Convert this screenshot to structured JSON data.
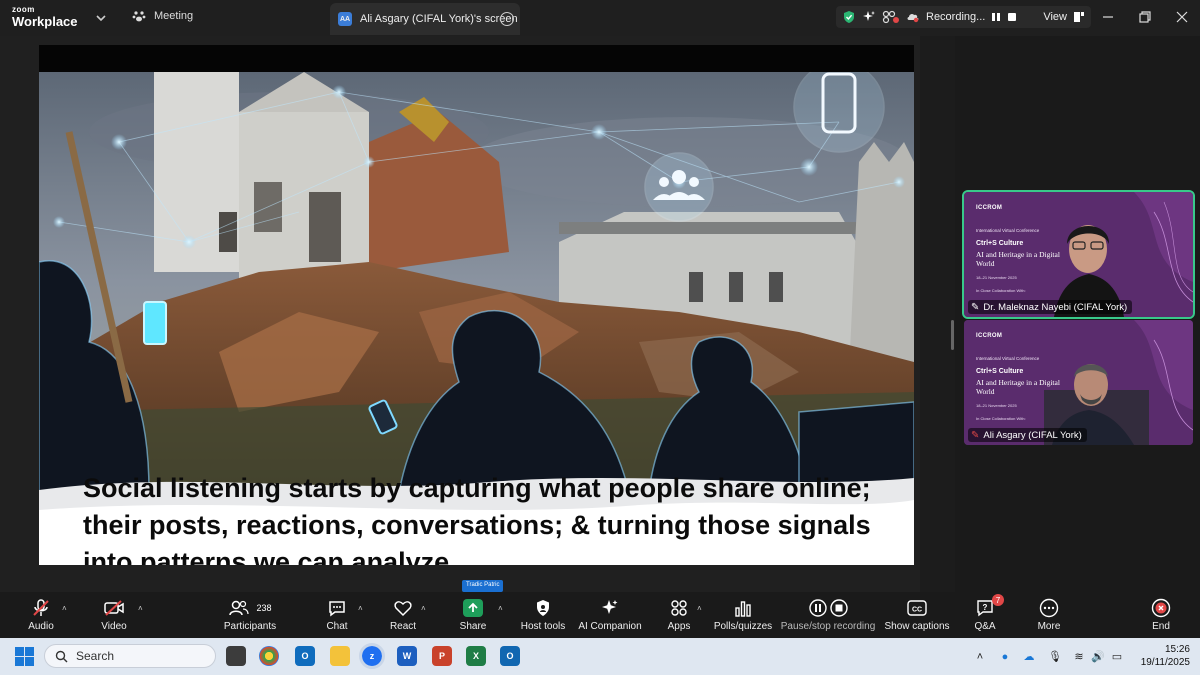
{
  "titlebar": {
    "logo_top": "zoom",
    "logo_bottom": "Workplace",
    "meeting_label": "Meeting",
    "screen_badge": "AA",
    "screen_tab_label": "Ali Asgary (CIFAL York)'s screen",
    "recording_label": "Recording...",
    "view_label": "View"
  },
  "slide": {
    "caption": "Social listening starts by capturing what people share online; their posts, reactions, conversations; & turning those signals into patterns we can analyze."
  },
  "gallery": {
    "tiles": [
      {
        "org": "ICCROM",
        "conference": "International Virtual Conference",
        "title": "Ctrl+S Culture",
        "subtitle": "AI and Heritage in a Digital World",
        "dates": "18–21 November 2025",
        "collab": "In Close Collaboration With:",
        "name": "Dr. Maleknaz Nayebi (CIFAL York)"
      },
      {
        "org": "ICCROM",
        "conference": "International Virtual Conference",
        "title": "Ctrl+S Culture",
        "subtitle": "AI and Heritage in a Digital World",
        "dates": "18–21 November 2025",
        "collab": "In Close Collaboration With:",
        "name": "Ali Asgary (CIFAL York)"
      }
    ]
  },
  "toolbar": {
    "audio": "Audio",
    "video": "Video",
    "participants": "Participants",
    "participants_count": "238",
    "chat": "Chat",
    "react": "React",
    "share": "Share",
    "host_tools": "Host tools",
    "ai_companion": "AI Companion",
    "apps": "Apps",
    "polls": "Polls/quizzes",
    "pause_recording": "Pause/stop recording",
    "captions": "Show captions",
    "qa": "Q&A",
    "qa_badge": "7",
    "more": "More",
    "end": "End",
    "tooltip": "Tradic Patric"
  },
  "taskbar": {
    "search_placeholder": "Search",
    "time": "15:26",
    "date": "19/11/2025"
  },
  "colors": {
    "accent_green": "#38c98a",
    "share_green": "#1e9e5a",
    "record_red": "#e14747",
    "tile_purple": "#5b2d6c"
  }
}
